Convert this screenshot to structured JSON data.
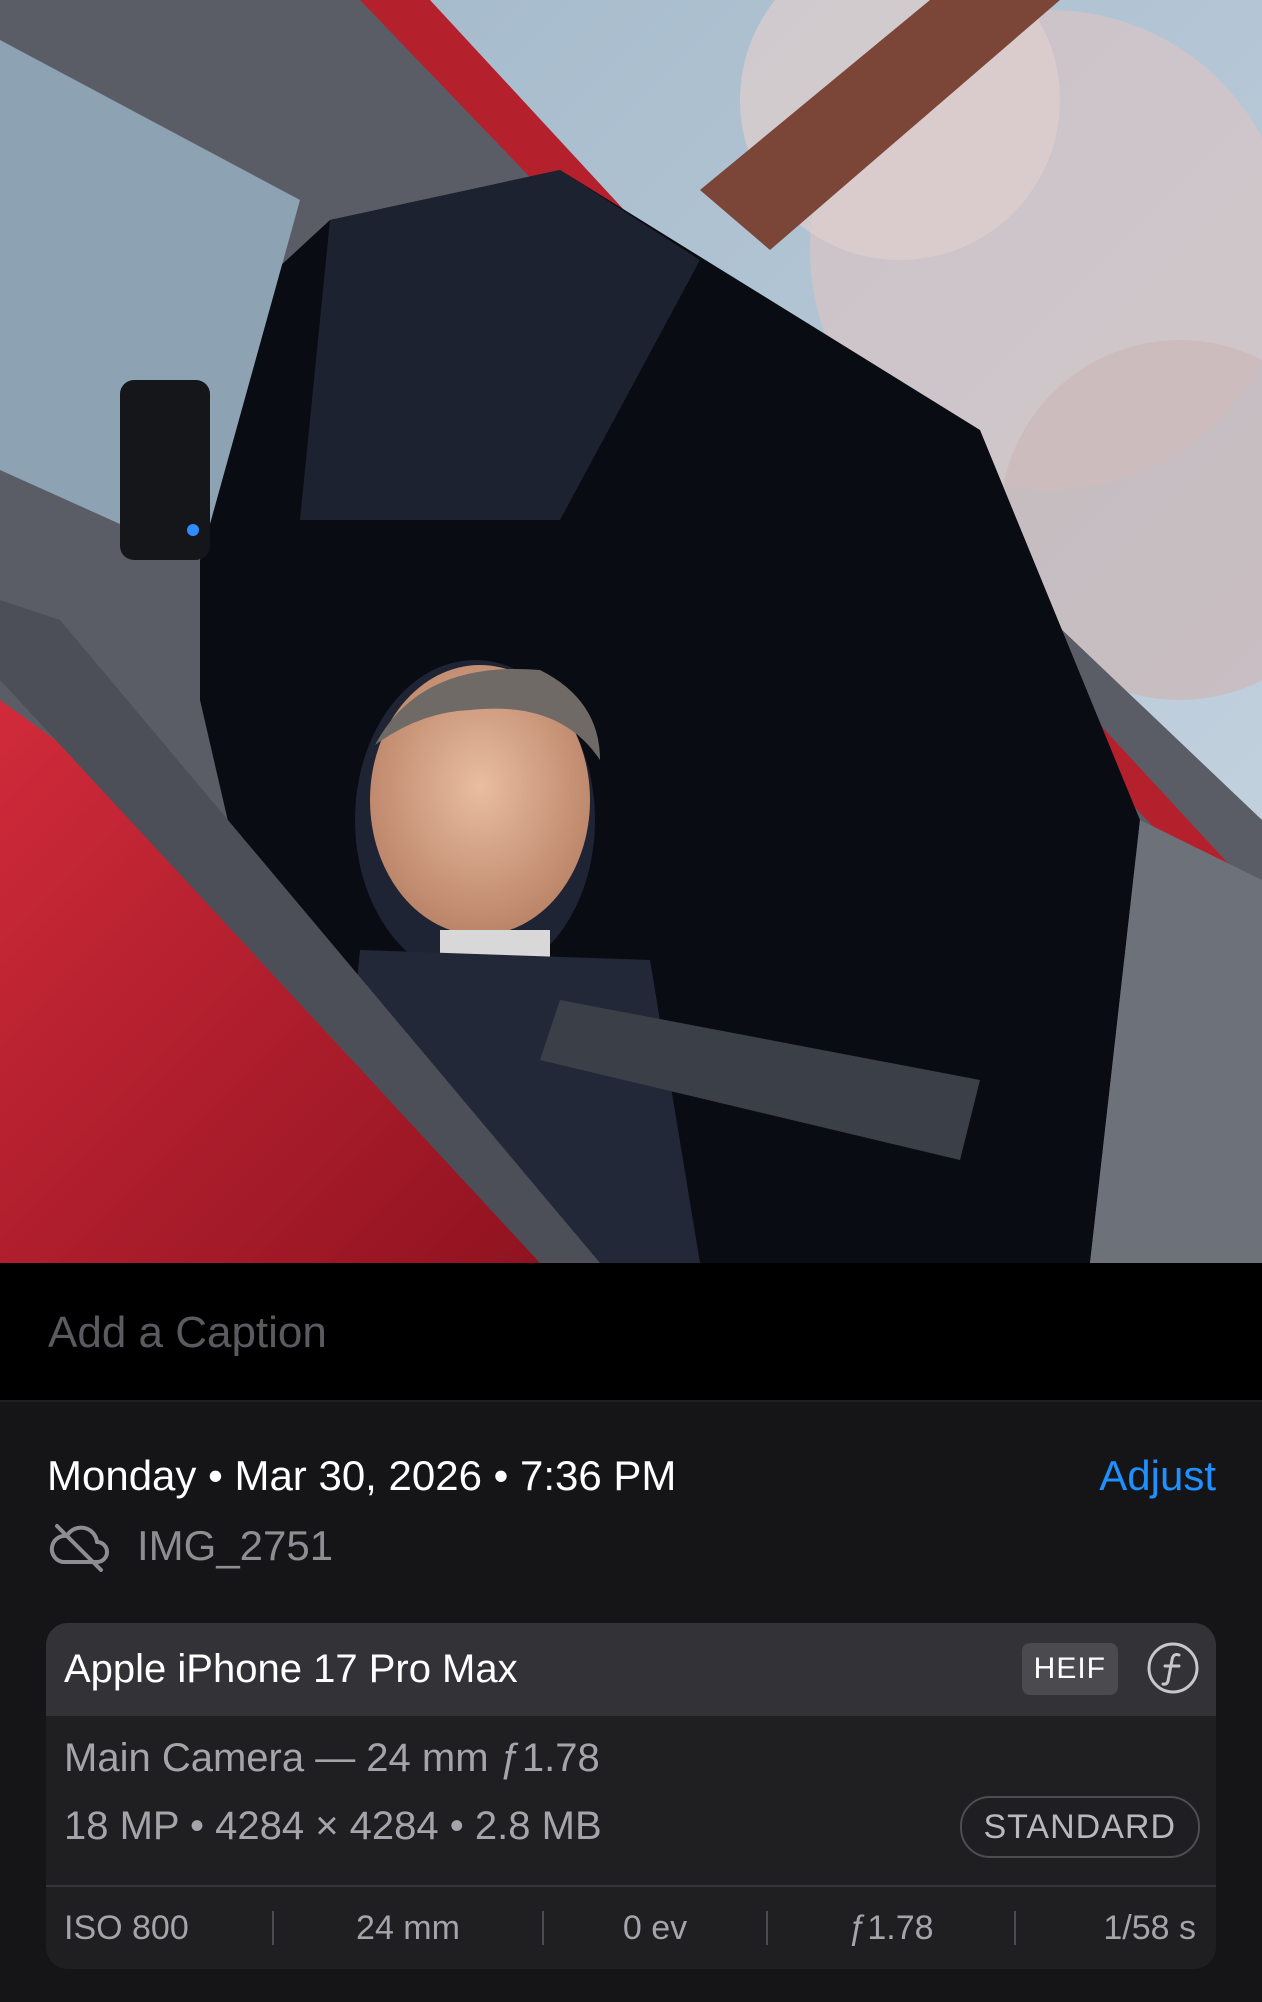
{
  "caption": {
    "placeholder": "Add a Caption"
  },
  "info": {
    "date_line": "Monday • Mar 30, 2026 • 7:36 PM",
    "adjust_label": "Adjust",
    "file_icon": "cloud-slash-icon",
    "file_name": "IMG_2751"
  },
  "camera": {
    "device": "Apple iPhone 17 Pro Max",
    "format": "HEIF",
    "format_icon": "function-f-icon",
    "lens": "Main Camera — 24 mm ƒ1.78",
    "specs": "18 MP • 4284 × 4284 • 2.8 MB",
    "style_badge": "STANDARD",
    "exif": {
      "iso": "ISO 800",
      "focal": "24 mm",
      "ev": "0 ev",
      "aperture": "ƒ1.78",
      "shutter": "1/58 s"
    }
  },
  "colors": {
    "accent": "#1e90ff",
    "background": "#000000",
    "panel": "#151517",
    "card": "#1f1f22"
  }
}
